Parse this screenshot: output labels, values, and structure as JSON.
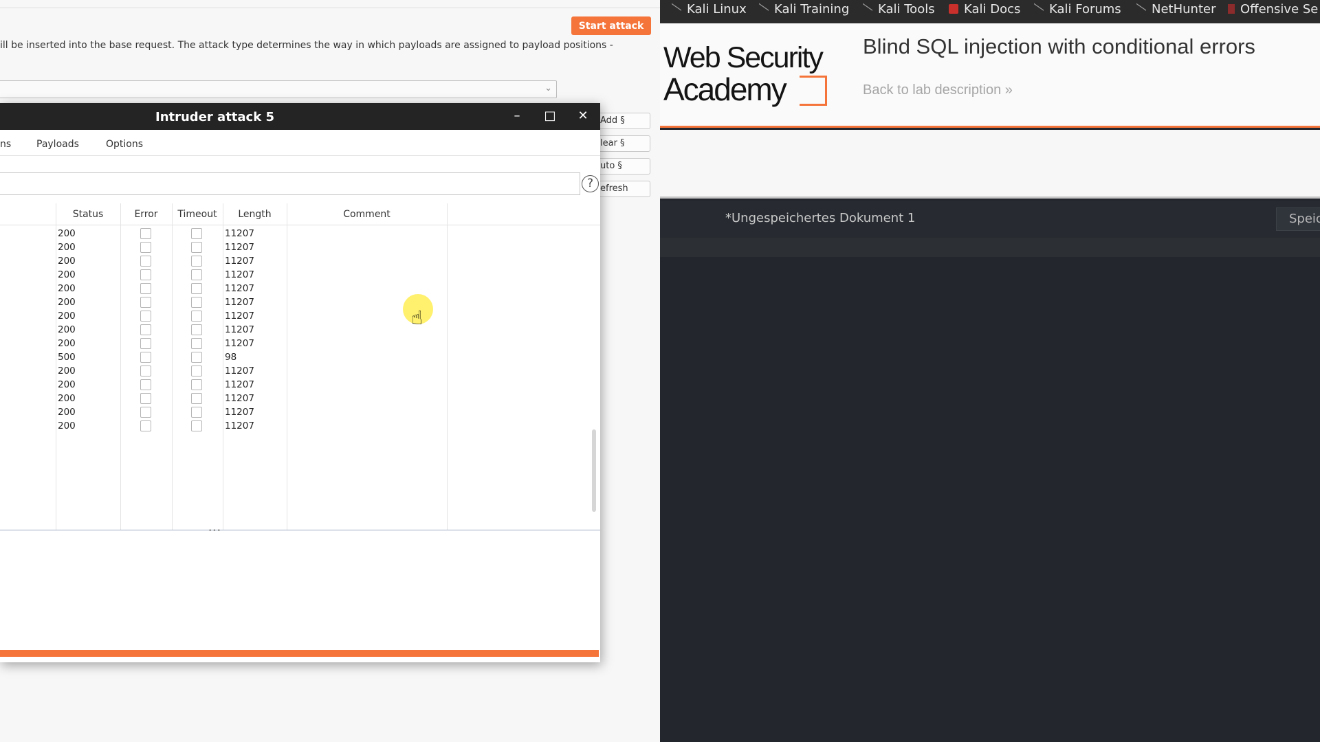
{
  "burp": {
    "start_attack": "Start attack",
    "info_text": "ill be inserted into the base request. The attack type determines the way in which payloads are assigned to payload positions -",
    "side_buttons": [
      "Add §",
      "lear §",
      "uto §",
      "efresh"
    ]
  },
  "attack_window": {
    "title": "Intruder attack 5",
    "controls": {
      "minimize": "–",
      "maximize": "□",
      "close": "✕"
    },
    "tabs": [
      "ns",
      "Payloads",
      "Options"
    ],
    "help": "?",
    "columns": [
      "Status",
      "Error",
      "Timeout",
      "Length",
      "Comment"
    ],
    "rows": [
      {
        "status": "200",
        "length": "11207"
      },
      {
        "status": "200",
        "length": "11207"
      },
      {
        "status": "200",
        "length": "11207"
      },
      {
        "status": "200",
        "length": "11207"
      },
      {
        "status": "200",
        "length": "11207"
      },
      {
        "status": "200",
        "length": "11207"
      },
      {
        "status": "200",
        "length": "11207"
      },
      {
        "status": "200",
        "length": "11207"
      },
      {
        "status": "200",
        "length": "11207"
      },
      {
        "status": "500",
        "length": "98"
      },
      {
        "status": "200",
        "length": "11207"
      },
      {
        "status": "200",
        "length": "11207"
      },
      {
        "status": "200",
        "length": "11207"
      },
      {
        "status": "200",
        "length": "11207"
      },
      {
        "status": "200",
        "length": "11207"
      }
    ],
    "progress_fraction": 1.0
  },
  "bookmarks": [
    {
      "label": "Kali Linux",
      "icon": "kali-dragon-icon"
    },
    {
      "label": "Kali Training",
      "icon": "kali-dragon-icon"
    },
    {
      "label": "Kali Tools",
      "icon": "kali-dragon-icon"
    },
    {
      "label": "Kali Docs",
      "icon": "kali-docs-icon"
    },
    {
      "label": "Kali Forums",
      "icon": "kali-dragon-icon"
    },
    {
      "label": "NetHunter",
      "icon": "kali-dragon-icon"
    },
    {
      "label": "Offensive Se",
      "icon": "offsec-icon"
    }
  ],
  "academy": {
    "logo_line1": "Web Security",
    "logo_line2": "Academy",
    "lab_title": "Blind SQL injection with conditional errors",
    "back_link": "Back to lab description »"
  },
  "editor": {
    "doc_title": "*Ungespeichertes Dokument 1",
    "save_label": "Speic"
  },
  "colors": {
    "accent": "#f5743a",
    "editor_bg": "#23272d",
    "titlebar": "#242424"
  }
}
